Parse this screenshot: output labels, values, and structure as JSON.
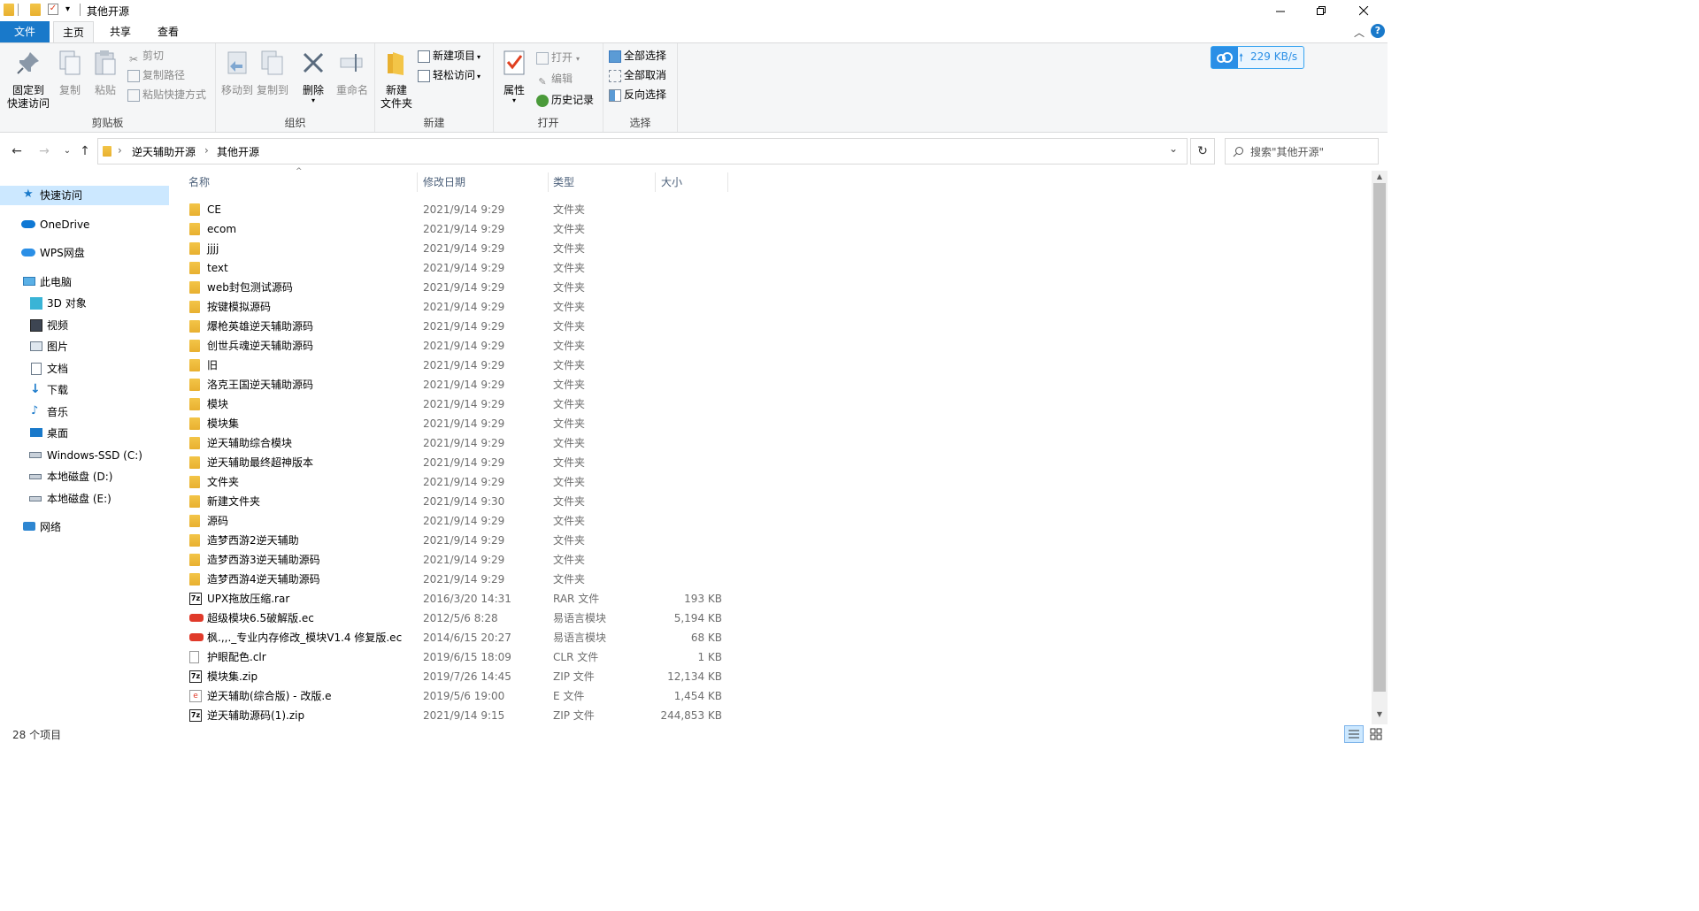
{
  "window": {
    "title": "其他开源",
    "qat_dropdown": "▾"
  },
  "tabs": {
    "file": "文件",
    "home": "主页",
    "share": "共享",
    "view": "查看"
  },
  "ribbon": {
    "clipboard": {
      "pin_l1": "固定到",
      "pin_l2": "快速访问",
      "copy": "复制",
      "paste": "粘贴",
      "cut": "剪切",
      "copy_path": "复制路径",
      "paste_shortcut": "粘贴快捷方式",
      "group": "剪贴板"
    },
    "organize": {
      "move_to": "移动到",
      "copy_to": "复制到",
      "delete": "删除",
      "rename": "重命名",
      "group": "组织"
    },
    "new": {
      "new_folder_l1": "新建",
      "new_folder_l2": "文件夹",
      "new_item": "新建项目",
      "easy_access": "轻松访问",
      "group": "新建"
    },
    "open": {
      "properties": "属性",
      "open": "打开",
      "edit": "编辑",
      "history": "历史记录",
      "group": "打开"
    },
    "select": {
      "select_all": "全部选择",
      "select_none": "全部取消",
      "invert": "反向选择",
      "group": "选择"
    }
  },
  "speed_widget": {
    "text": "229 KB/s",
    "arrow": "🠕"
  },
  "address": {
    "crumbs": [
      "逆天辅助开源",
      "其他开源"
    ],
    "sep": "›"
  },
  "search": {
    "placeholder": "搜索\"其他开源\""
  },
  "navpane": {
    "quick_access": "快速访问",
    "onedrive": "OneDrive",
    "wps": "WPS网盘",
    "this_pc": "此电脑",
    "items": [
      "3D 对象",
      "视频",
      "图片",
      "文档",
      "下载",
      "音乐",
      "桌面",
      "Windows-SSD (C:)",
      "本地磁盘 (D:)",
      "本地磁盘 (E:)"
    ],
    "network": "网络"
  },
  "columns": {
    "name": "名称",
    "date": "修改日期",
    "type": "类型",
    "size": "大小"
  },
  "files": [
    {
      "name": "CE",
      "date": "2021/9/14 9:29",
      "type": "文件夹",
      "size": "",
      "icon": "folder"
    },
    {
      "name": "ecom",
      "date": "2021/9/14 9:29",
      "type": "文件夹",
      "size": "",
      "icon": "folder"
    },
    {
      "name": "jjjj",
      "date": "2021/9/14 9:29",
      "type": "文件夹",
      "size": "",
      "icon": "folder"
    },
    {
      "name": "text",
      "date": "2021/9/14 9:29",
      "type": "文件夹",
      "size": "",
      "icon": "folder"
    },
    {
      "name": "web封包测试源码",
      "date": "2021/9/14 9:29",
      "type": "文件夹",
      "size": "",
      "icon": "folder"
    },
    {
      "name": "按键模拟源码",
      "date": "2021/9/14 9:29",
      "type": "文件夹",
      "size": "",
      "icon": "folder"
    },
    {
      "name": "爆枪英雄逆天辅助源码",
      "date": "2021/9/14 9:29",
      "type": "文件夹",
      "size": "",
      "icon": "folder"
    },
    {
      "name": "创世兵魂逆天辅助源码",
      "date": "2021/9/14 9:29",
      "type": "文件夹",
      "size": "",
      "icon": "folder"
    },
    {
      "name": "旧",
      "date": "2021/9/14 9:29",
      "type": "文件夹",
      "size": "",
      "icon": "folder"
    },
    {
      "name": "洛克王国逆天辅助源码",
      "date": "2021/9/14 9:29",
      "type": "文件夹",
      "size": "",
      "icon": "folder"
    },
    {
      "name": "模块",
      "date": "2021/9/14 9:29",
      "type": "文件夹",
      "size": "",
      "icon": "folder"
    },
    {
      "name": "模块集",
      "date": "2021/9/14 9:29",
      "type": "文件夹",
      "size": "",
      "icon": "folder"
    },
    {
      "name": "逆天辅助综合模块",
      "date": "2021/9/14 9:29",
      "type": "文件夹",
      "size": "",
      "icon": "folder"
    },
    {
      "name": "逆天辅助最终超神版本",
      "date": "2021/9/14 9:29",
      "type": "文件夹",
      "size": "",
      "icon": "folder"
    },
    {
      "name": "文件夹",
      "date": "2021/9/14 9:29",
      "type": "文件夹",
      "size": "",
      "icon": "folder"
    },
    {
      "name": "新建文件夹",
      "date": "2021/9/14 9:30",
      "type": "文件夹",
      "size": "",
      "icon": "folder"
    },
    {
      "name": "源码",
      "date": "2021/9/14 9:29",
      "type": "文件夹",
      "size": "",
      "icon": "folder"
    },
    {
      "name": "造梦西游2逆天辅助",
      "date": "2021/9/14 9:29",
      "type": "文件夹",
      "size": "",
      "icon": "folder"
    },
    {
      "name": "造梦西游3逆天辅助源码",
      "date": "2021/9/14 9:29",
      "type": "文件夹",
      "size": "",
      "icon": "folder"
    },
    {
      "name": "造梦西游4逆天辅助源码",
      "date": "2021/9/14 9:29",
      "type": "文件夹",
      "size": "",
      "icon": "folder"
    },
    {
      "name": "UPX拖放压缩.rar",
      "date": "2016/3/20 14:31",
      "type": "RAR 文件",
      "size": "193 KB",
      "icon": "archive"
    },
    {
      "name": "超级模块6.5破解版.ec",
      "date": "2012/5/6 8:28",
      "type": "易语言模块",
      "size": "5,194 KB",
      "icon": "ec"
    },
    {
      "name": "枫.,,._专业内存修改_模块V1.4 修复版.ec",
      "date": "2014/6/15 20:27",
      "type": "易语言模块",
      "size": "68 KB",
      "icon": "ec"
    },
    {
      "name": "护眼配色.clr",
      "date": "2019/6/15 18:09",
      "type": "CLR 文件",
      "size": "1 KB",
      "icon": "blank"
    },
    {
      "name": "模块集.zip",
      "date": "2019/7/26 14:45",
      "type": "ZIP 文件",
      "size": "12,134 KB",
      "icon": "archive"
    },
    {
      "name": "逆天辅助(综合版) - 改版.e",
      "date": "2019/5/6 19:00",
      "type": "E 文件",
      "size": "1,454 KB",
      "icon": "e"
    },
    {
      "name": "逆天辅助源码(1).zip",
      "date": "2021/9/14 9:15",
      "type": "ZIP 文件",
      "size": "244,853 KB",
      "icon": "archive"
    }
  ],
  "status": {
    "count": "28 个项目"
  }
}
